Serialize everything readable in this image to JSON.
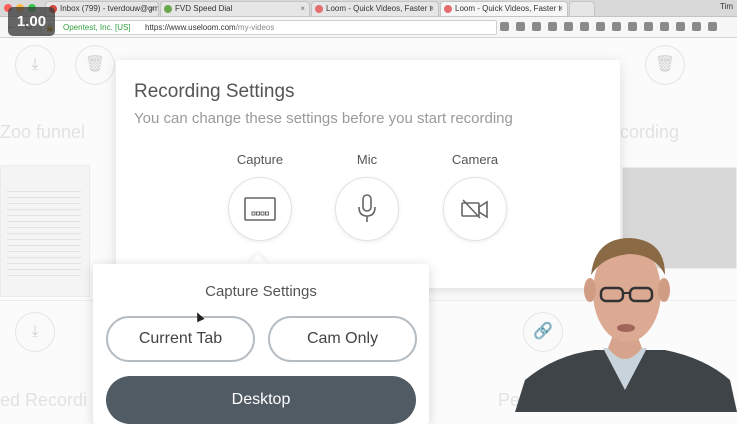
{
  "playback_speed": "1.00",
  "browser": {
    "tabs": [
      {
        "title": "Inbox (799) - tverdouw@gm",
        "favicon_color": "#d44638",
        "active": false
      },
      {
        "title": "FVD Speed Dial",
        "favicon_color": "#6aa84f",
        "active": false
      },
      {
        "title": "Loom - Quick Videos, Faster t",
        "favicon_color": "#e46d6d",
        "active": false
      },
      {
        "title": "Loom - Quick Videos, Faster t",
        "favicon_color": "#e46d6d",
        "active": true
      }
    ],
    "user_name": "Tim",
    "secure_label": "Opentest, Inc. [US]",
    "url_host": "https://www.useloom.com",
    "url_path": "/my-videos"
  },
  "background_titles": [
    "Zoo funnel",
    "cording",
    "ed Recordi",
    "Pe"
  ],
  "recording_settings": {
    "title": "Recording Settings",
    "subtitle": "You can change these settings before you start recording",
    "options": [
      {
        "label": "Capture",
        "icon": "screen-icon"
      },
      {
        "label": "Mic",
        "icon": "microphone-icon"
      },
      {
        "label": "Camera",
        "icon": "camera-off-icon"
      }
    ]
  },
  "capture_settings": {
    "title": "Capture Settings",
    "current_tab_label": "Current Tab",
    "cam_only_label": "Cam Only",
    "desktop_label": "Desktop"
  },
  "colors": {
    "accent_dark": "#515b64",
    "pill_border": "#b5bcc2"
  }
}
